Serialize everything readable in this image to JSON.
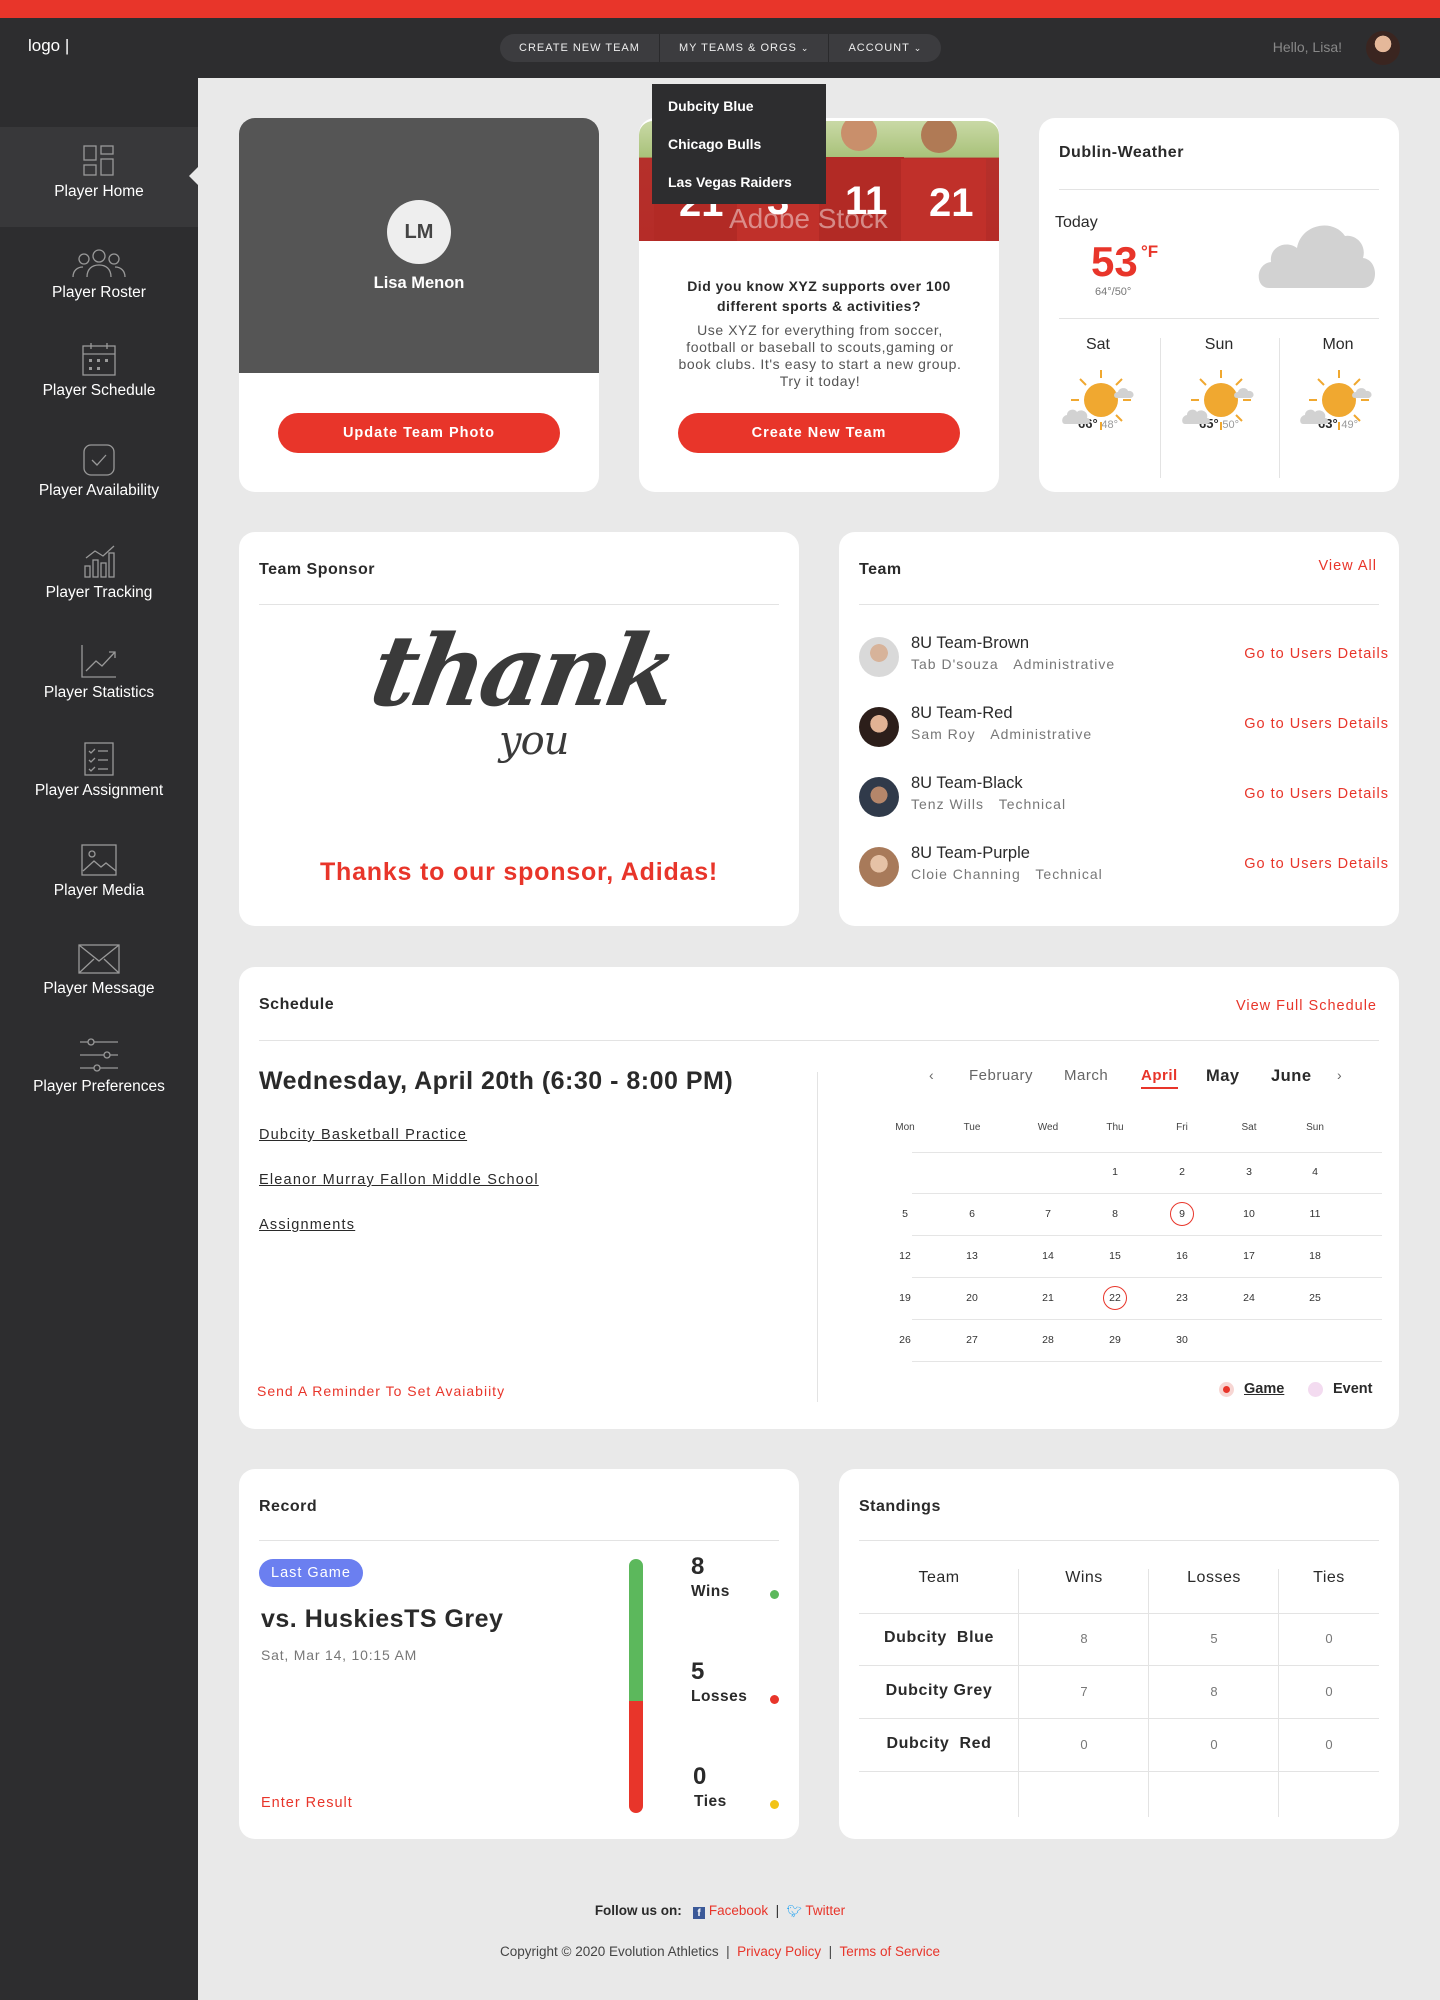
{
  "header": {
    "logo": "logo |",
    "nav": [
      "CREATE NEW TEAM",
      "MY TEAMS & ORGS",
      "ACCOUNT"
    ],
    "greeting": "Hello, Lisa!"
  },
  "teams_dropdown": [
    "Dubcity Blue",
    "Chicago Bulls",
    "Las Vegas Raiders"
  ],
  "sidebar": {
    "items": [
      {
        "label": "Player Home",
        "icon": "dashboard-icon"
      },
      {
        "label": "Player Roster",
        "icon": "group-icon"
      },
      {
        "label": "Player Schedule",
        "icon": "calendar-icon"
      },
      {
        "label": "Player Availability",
        "icon": "checkbox-icon"
      },
      {
        "label": "Player Tracking",
        "icon": "bar-chart-icon"
      },
      {
        "label": "Player Statistics",
        "icon": "trend-icon"
      },
      {
        "label": "Player Assignment",
        "icon": "checklist-icon"
      },
      {
        "label": "Player Media",
        "icon": "image-icon"
      },
      {
        "label": "Player Message",
        "icon": "envelope-icon"
      },
      {
        "label": "Player Preferences",
        "icon": "sliders-icon"
      }
    ]
  },
  "profile": {
    "initials": "LM",
    "name": "Lisa Menon",
    "button": "Update Team Photo"
  },
  "promo": {
    "watermark": "Adobe Stock",
    "jerseys": [
      "21",
      "3",
      "11",
      "21"
    ],
    "question": "Did you know XYZ supports over 100 different sports & activities?",
    "text": "Use XYZ for everything from soccer, football or baseball to scouts,gaming or book clubs. It's easy to start a new group. Try it today!",
    "button": "Create New Team"
  },
  "weather": {
    "title": "Dublin-Weather",
    "today_label": "Today",
    "today_temp": "53",
    "unit": "°F",
    "today_range": "64°/50°",
    "forecast": [
      {
        "day": "Sat",
        "high": "66°",
        "low": "48°"
      },
      {
        "day": "Sun",
        "high": "65°",
        "low": "50°"
      },
      {
        "day": "Mon",
        "high": "63°",
        "low": "49°"
      }
    ]
  },
  "sponsor": {
    "title": "Team Sponsor",
    "script_top": "thank",
    "script_bottom": "you",
    "message": "Thanks to our sponsor, Adidas!"
  },
  "team": {
    "title": "Team",
    "view_all": "View All",
    "link_label": "Go to Users Details",
    "rows": [
      {
        "name": "8U Team-Brown",
        "person": "Tab D'souza",
        "role": "Administrative"
      },
      {
        "name": "8U Team-Red",
        "person": "Sam Roy",
        "role": "Administrative"
      },
      {
        "name": "8U Team-Black",
        "person": "Tenz Wills",
        "role": "Technical"
      },
      {
        "name": "8U Team-Purple",
        "person": "Cloie Channing",
        "role": "Technical"
      }
    ]
  },
  "schedule": {
    "title": "Schedule",
    "view_full": "View Full Schedule",
    "when": "Wednesday, April 20th (6:30 - 8:00 PM)",
    "links": [
      "Dubcity Basketball Practice",
      "Eleanor Murray Fallon Middle School",
      "Assignments"
    ],
    "reminder": "Send A Reminder To Set Avaiabiity",
    "months": [
      "February",
      "March",
      "April",
      "May",
      "June"
    ],
    "prev": "‹",
    "next": "›",
    "weekdays": [
      "Mon",
      "Tue",
      "Wed",
      "Thu",
      "Fri",
      "Sat",
      "Sun"
    ],
    "days": [
      [
        "",
        "",
        "",
        "1",
        "2",
        "3",
        "4"
      ],
      [
        "5",
        "6",
        "7",
        "8",
        "9",
        "10",
        "11"
      ],
      [
        "12",
        "13",
        "14",
        "15",
        "16",
        "17",
        "18"
      ],
      [
        "19",
        "20",
        "21",
        "22",
        "23",
        "24",
        "25"
      ],
      [
        "26",
        "27",
        "28",
        "29",
        "30",
        "",
        ""
      ]
    ],
    "legend": [
      "Game",
      "Event"
    ]
  },
  "record": {
    "title": "Record",
    "badge": "Last Game",
    "opponent": "vs. HuskiesTS Grey",
    "date": "Sat, Mar 14, 10:15 AM",
    "enter_result": "Enter Result",
    "wins": "8",
    "wins_label": "Wins",
    "losses": "5",
    "losses_label": "Losses",
    "ties": "0",
    "ties_label": "Ties"
  },
  "standings": {
    "title": "Standings",
    "headers": [
      "Team",
      "Wins",
      "Losses",
      "Ties"
    ],
    "rows": [
      [
        "Dubcity  Blue",
        "8",
        "5",
        "0"
      ],
      [
        "Dubcity Grey",
        "7",
        "8",
        "0"
      ],
      [
        "Dubcity  Red",
        "0",
        "0",
        "0"
      ]
    ]
  },
  "footer": {
    "follow": "Follow us on:",
    "facebook": "Facebook",
    "twitter": "Twitter",
    "copyright": "Copyright © 2020 Evolution Athletics",
    "privacy": "Privacy Policy",
    "terms": "Terms of Service"
  },
  "colors": {
    "accent": "#e8352a",
    "sidebar": "#2d2d2f",
    "badge": "#6b7ff0",
    "wins": "#5cb85c",
    "ties": "#f2c316",
    "event": "#f3dbf0"
  }
}
